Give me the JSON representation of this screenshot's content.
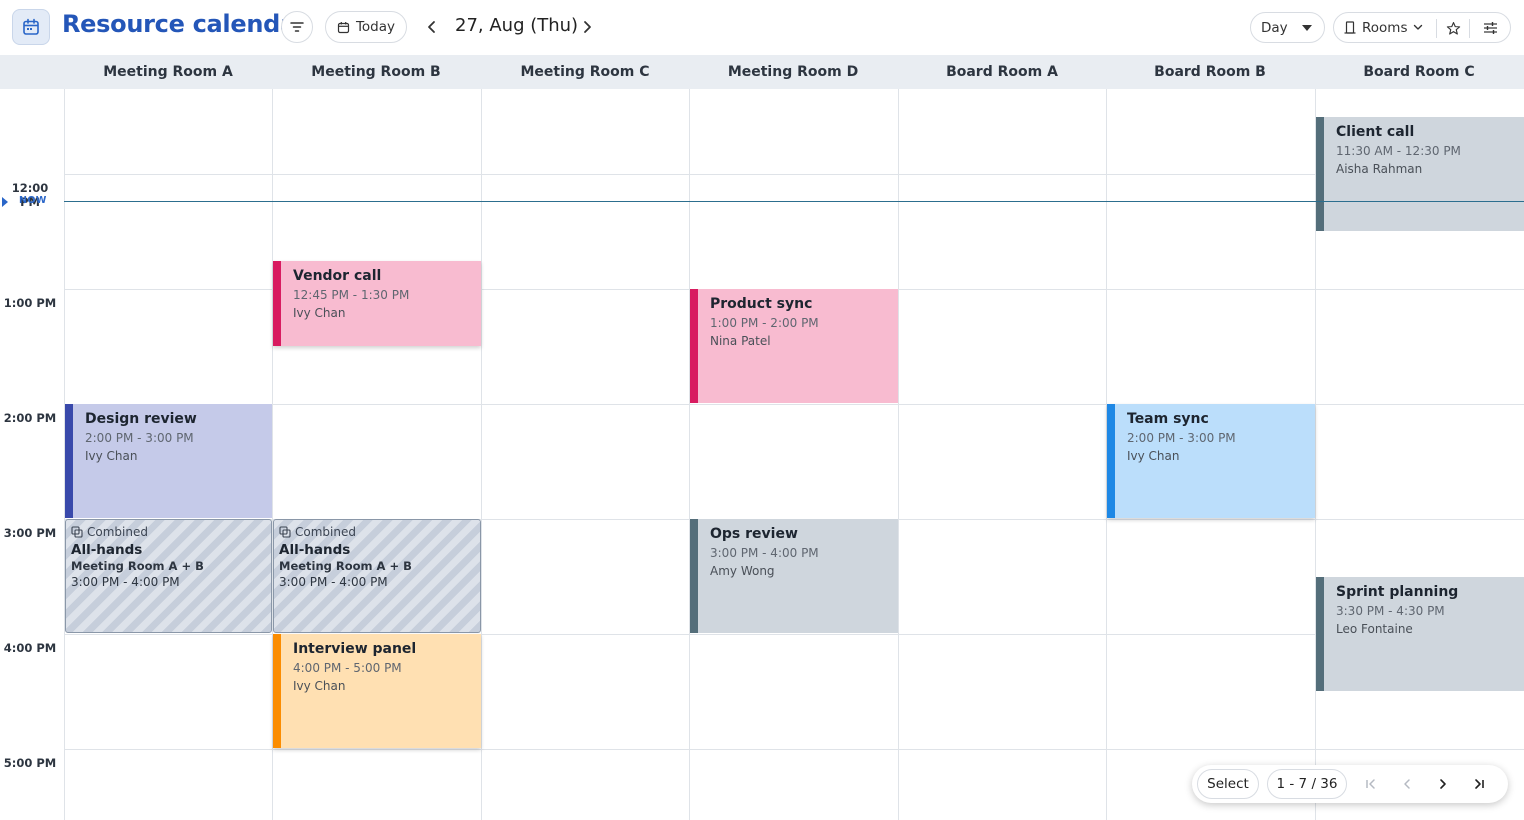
{
  "header": {
    "title": "Resource calendar",
    "today_label": "Today",
    "date_label": "27, Aug (Thu)",
    "view_label": "Day",
    "resource_label": "Rooms"
  },
  "rooms": [
    "Meeting Room A",
    "Meeting Room B",
    "Meeting Room C",
    "Meeting Room D",
    "Board Room A",
    "Board Room B",
    "Board Room C"
  ],
  "time_labels": [
    "12:00 PM",
    "1:00 PM",
    "2:00 PM",
    "3:00 PM",
    "4:00 PM",
    "5:00 PM"
  ],
  "now_label": "NOW",
  "events": [
    {
      "title": "Client call",
      "time": "11:30 AM - 12:30 PM",
      "person": "Aisha Rahman",
      "room": "Board Room C",
      "color": "#cfd6dd",
      "accent": "#546e7a"
    },
    {
      "title": "Vendor call",
      "time": "12:45 PM - 1:30 PM",
      "person": "Ivy Chan",
      "room": "Meeting Room B",
      "color": "#f8bbd0",
      "accent": "#d81b60"
    },
    {
      "title": "Product sync",
      "time": "1:00 PM - 2:00 PM",
      "person": "Nina Patel",
      "room": "Meeting Room D",
      "color": "#f8bbd0",
      "accent": "#d81b60"
    },
    {
      "title": "Design review",
      "time": "2:00 PM - 3:00 PM",
      "person": "Ivy Chan",
      "room": "Meeting Room A",
      "color": "#c5cae9",
      "accent": "#3949ab"
    },
    {
      "title": "Team sync",
      "time": "2:00 PM - 3:00 PM",
      "person": "Ivy Chan",
      "room": "Board Room B",
      "color": "#bbdefb",
      "accent": "#1e88e5"
    },
    {
      "title": "Ops review",
      "time": "3:00 PM - 4:00 PM",
      "person": "Amy Wong",
      "room": "Meeting Room D",
      "color": "#cfd6dd",
      "accent": "#546e7a"
    },
    {
      "title": "Sprint planning",
      "time": "3:30 PM - 4:30 PM",
      "person": "Leo Fontaine",
      "room": "Board Room C",
      "color": "#cfd6dd",
      "accent": "#546e7a"
    },
    {
      "title": "Interview panel",
      "time": "4:00 PM - 5:00 PM",
      "person": "Ivy Chan",
      "room": "Meeting Room B",
      "color": "#ffe0b2",
      "accent": "#fb8c00"
    }
  ],
  "combined_events": [
    {
      "tag": "Combined",
      "title": "All-hands",
      "rooms": "Meeting Room A + B",
      "time": "3:00 PM - 4:00 PM"
    },
    {
      "tag": "Combined",
      "title": "All-hands",
      "rooms": "Meeting Room A + B",
      "time": "3:00 PM - 4:00 PM"
    }
  ],
  "pager": {
    "select_label": "Select",
    "range_label": "1 - 7 / 36"
  }
}
